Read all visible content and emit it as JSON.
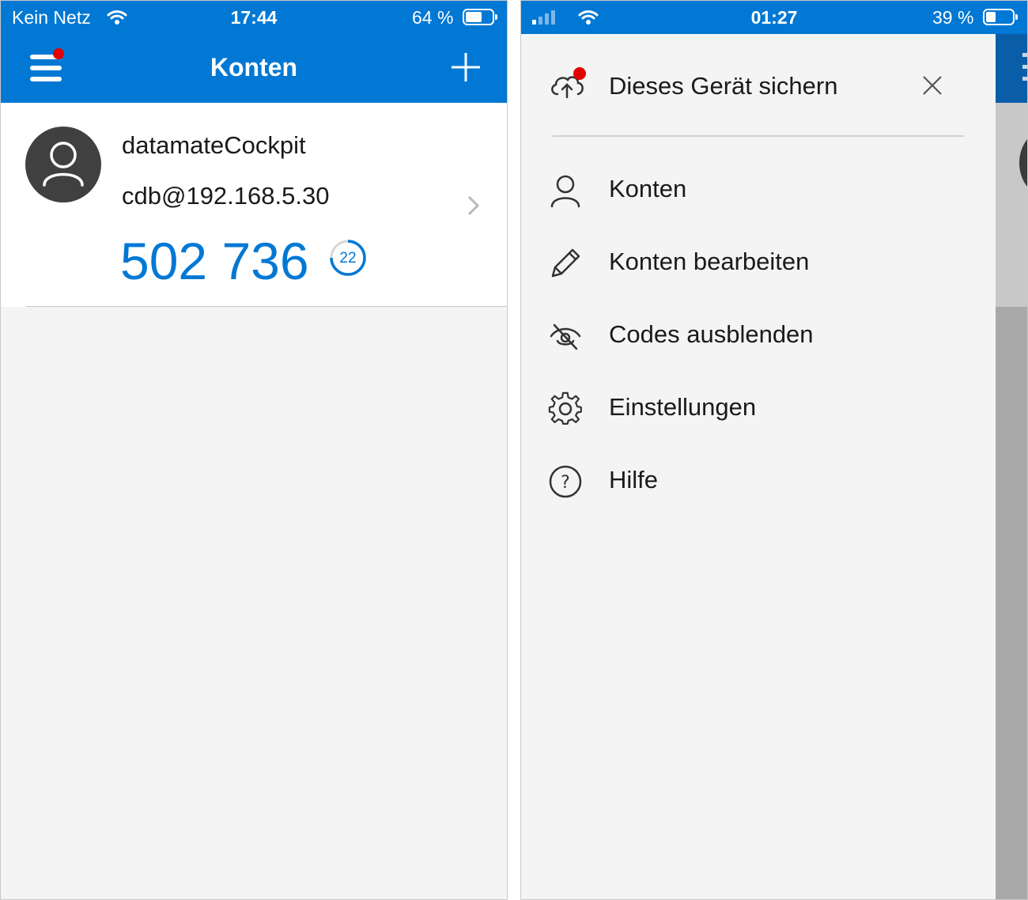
{
  "left_screen": {
    "status": {
      "carrier": "Kein Netz",
      "time": "17:44",
      "battery": "64 %",
      "battery_fill": 0.64
    },
    "header": {
      "title": "Konten"
    },
    "account": {
      "name": "datamateCockpit",
      "user": "cdb@192.168.5.30",
      "code": "502 736",
      "seconds_left": "22"
    }
  },
  "right_screen": {
    "status": {
      "time": "01:27",
      "battery": "39 %",
      "battery_fill": 0.39
    },
    "drawer": {
      "backup_label": "Dieses Gerät sichern",
      "items": [
        {
          "label": "Konten",
          "icon": "person-icon"
        },
        {
          "label": "Konten bearbeiten",
          "icon": "pencil-icon"
        },
        {
          "label": "Codes ausblenden",
          "icon": "eye-hidden-icon"
        },
        {
          "label": "Einstellungen",
          "icon": "gear-icon"
        },
        {
          "label": "Hilfe",
          "icon": "help-icon"
        }
      ]
    }
  },
  "colors": {
    "accent": "#0078d4",
    "notification": "#e30000",
    "background": "#f4f4f4"
  }
}
